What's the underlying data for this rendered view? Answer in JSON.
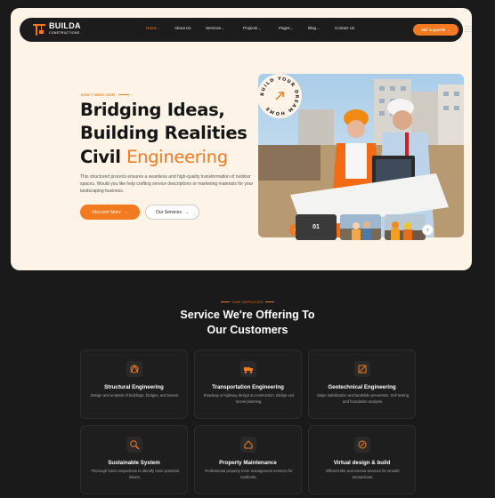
{
  "brand": {
    "name": "BUILDA",
    "tagline": "CONSTRUCTIONS"
  },
  "nav": {
    "items": [
      {
        "label": "Home",
        "caret": "⌄"
      },
      {
        "label": "About Us",
        "caret": ""
      },
      {
        "label": "Services",
        "caret": "⌄"
      },
      {
        "label": "Projects",
        "caret": "⌄"
      },
      {
        "label": "Pages",
        "caret": "⌄"
      },
      {
        "label": "Blog",
        "caret": "⌄"
      },
      {
        "label": "Contact Us",
        "caret": ""
      }
    ],
    "cta": "GET A QUOTE",
    "cta_arrow": "→"
  },
  "hero": {
    "eyebrow": "DON'T MISS OUT!",
    "line1": "Bridging Ideas,",
    "line2": "Building Realities",
    "line3_plain": "Civil",
    "line3_accent": "Engineering",
    "description": "This structured process ensures a seamless and high-quality transformation of outdoor spaces. Would you like help crafting service descriptions or marketing materials for your landscaping business.",
    "primary_btn": "Discover More",
    "secondary_btn": "Our Services",
    "arrow": "→",
    "badge_text": "BUILD YOUR DREAM HOME",
    "slide_number": "01",
    "prev_arrow": "‹",
    "next_arrow": "›"
  },
  "services": {
    "eyebrow": "OUR SERVICES",
    "title_line1": "Service We're Offering To",
    "title_line2": "Our Customers",
    "items": [
      {
        "title": "Structural Engineering",
        "desc": "Design and analysis of buildings, bridges, and towers.",
        "icon": "structure-icon"
      },
      {
        "title": "Transportation Engineering",
        "desc": "Roadway & highway design & construction. Bridge and tunnel planning.",
        "icon": "truck-icon"
      },
      {
        "title": "Geotechnical Engineering",
        "desc": "Slope stabilization and landslide prevention. Soil testing and foundation analysis.",
        "icon": "tools-icon"
      },
      {
        "title": "Sustainable System",
        "desc": "Thorough home inspections to identify more potential issues.",
        "icon": "magnifier-icon"
      },
      {
        "title": "Property Maintenance",
        "desc": "Professional property more management services for landlords.",
        "icon": "house-hand-icon"
      },
      {
        "title": "Virtual design & build",
        "desc": "Efficient title and escrow services for smooth transactions.",
        "icon": "design-icon"
      }
    ]
  },
  "colors": {
    "accent": "#f47a1f",
    "dark": "#1a1a1a",
    "cream": "#fdf3e7"
  }
}
